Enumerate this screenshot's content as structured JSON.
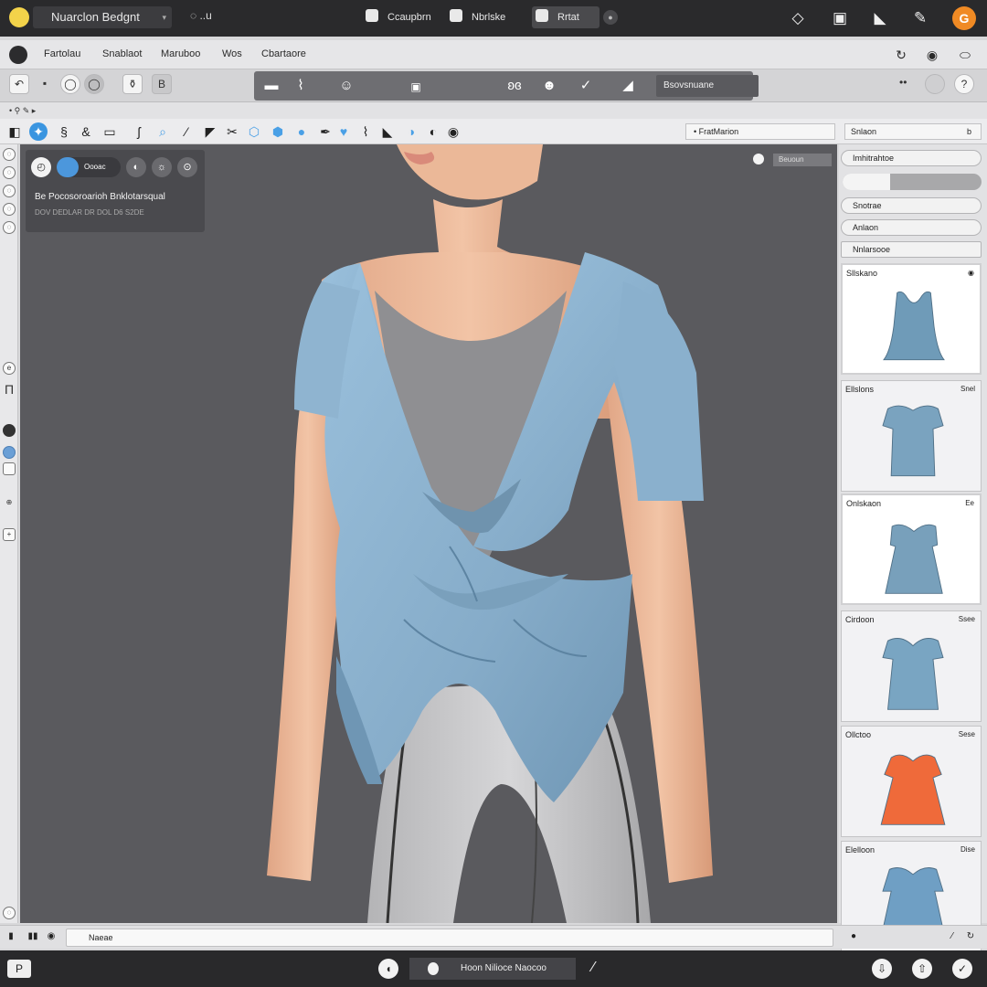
{
  "titlebar": {
    "title": "Nuarclon Bedgnt",
    "status": "◌ ..u",
    "tabs": [
      {
        "label": "Ccaupbrn"
      },
      {
        "label": "Nbrlske"
      },
      {
        "label": "Rrtat"
      }
    ],
    "right_icons": [
      "diamond-icon",
      "bucket-icon",
      "shoe-icon",
      "pen-icon"
    ],
    "avatar": "G"
  },
  "menubar": {
    "items": [
      "Fartolau",
      "Snablaot",
      "Maruboo",
      "Wos",
      "Cbartaore"
    ]
  },
  "toolbar1": {
    "field_label": "Bsovsnuane"
  },
  "crumbstrip": {
    "text": "• ⚲ ✎ ▸"
  },
  "toolsrow": {
    "field_label": "• FratMarion",
    "field2_label": "Snlaon",
    "field2_arrow": "b"
  },
  "viewport": {
    "panel": {
      "toggle_label": "Oooac",
      "row1": "Be Pocosoroarioh Bnklotarsqual",
      "row2": "DOV DEDLAR DR DOL D6 S2DE"
    },
    "corner_label": "Beuoun"
  },
  "rightpanel": {
    "header_row": "Imhitrahtoe",
    "slider_level": 0.34,
    "row_a": "Snotrae",
    "row_b": "Anlaon",
    "row_c": "Nnlarsooe",
    "thumbnails": [
      {
        "label": "Sllskano",
        "tag": "◉",
        "color": "#6f9bb8"
      },
      {
        "label": "Ellslons",
        "tag": "Snel",
        "color": "#7aa3bf"
      },
      {
        "label": "Onlskaon",
        "tag": "Ee",
        "color": "#78a0bb"
      },
      {
        "label": "Cirdoon",
        "tag": "Ssee",
        "color": "#79a5c2"
      },
      {
        "label": "Ollctoo",
        "tag": "Sese",
        "color": "#ef6a3a"
      },
      {
        "label": "Elelloon",
        "tag": "Dise",
        "color": "#6f9fc4"
      }
    ]
  },
  "bottomstrip": {
    "field_label": "Naeae"
  },
  "footer": {
    "center_label": "Hoon Nilioce  Naocoo",
    "left_label": "P"
  },
  "colors": {
    "accent_blue": "#3a95e0",
    "garment_blue": "#8eb4d2",
    "avatar_orange": "#f08a24",
    "chrome_dark": "#2a2a2c"
  }
}
